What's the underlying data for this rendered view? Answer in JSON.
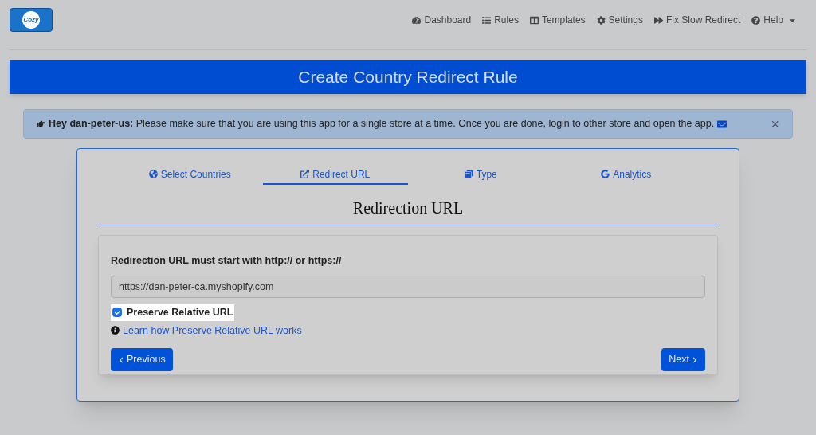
{
  "logo": {
    "text": "Cozy"
  },
  "nav": [
    {
      "label": "Dashboard"
    },
    {
      "label": "Rules"
    },
    {
      "label": "Templates"
    },
    {
      "label": "Settings"
    },
    {
      "label": "Fix Slow Redirect"
    },
    {
      "label": "Help"
    }
  ],
  "banner": {
    "title": "Create Country Redirect Rule"
  },
  "alert": {
    "text": "**Hey dan-peter-us:** Please make sure that you are using this app for a single store at a time. Once you are done, login to other store and open the app.",
    "close": "×"
  },
  "tabs": [
    {
      "label": "Select Countries",
      "selected": false
    },
    {
      "label": "Redirect URL",
      "selected": true
    },
    {
      "label": "Type",
      "selected": false
    },
    {
      "label": "Analytics",
      "selected": false
    }
  ],
  "section": {
    "title": "Redirection URL"
  },
  "form": {
    "label": "Redirection URL must start with http:// or https://",
    "value": "https://dan-peter-ca.myshopify.com",
    "checkbox": {
      "label": "Preserve Relative URL",
      "checked": true
    },
    "help_link": "Learn how Preserve Relative URL works"
  },
  "buttons": [
    {
      "label": "Previous",
      "kind": "previous"
    },
    {
      "label": "Next",
      "kind": "next"
    }
  ]
}
